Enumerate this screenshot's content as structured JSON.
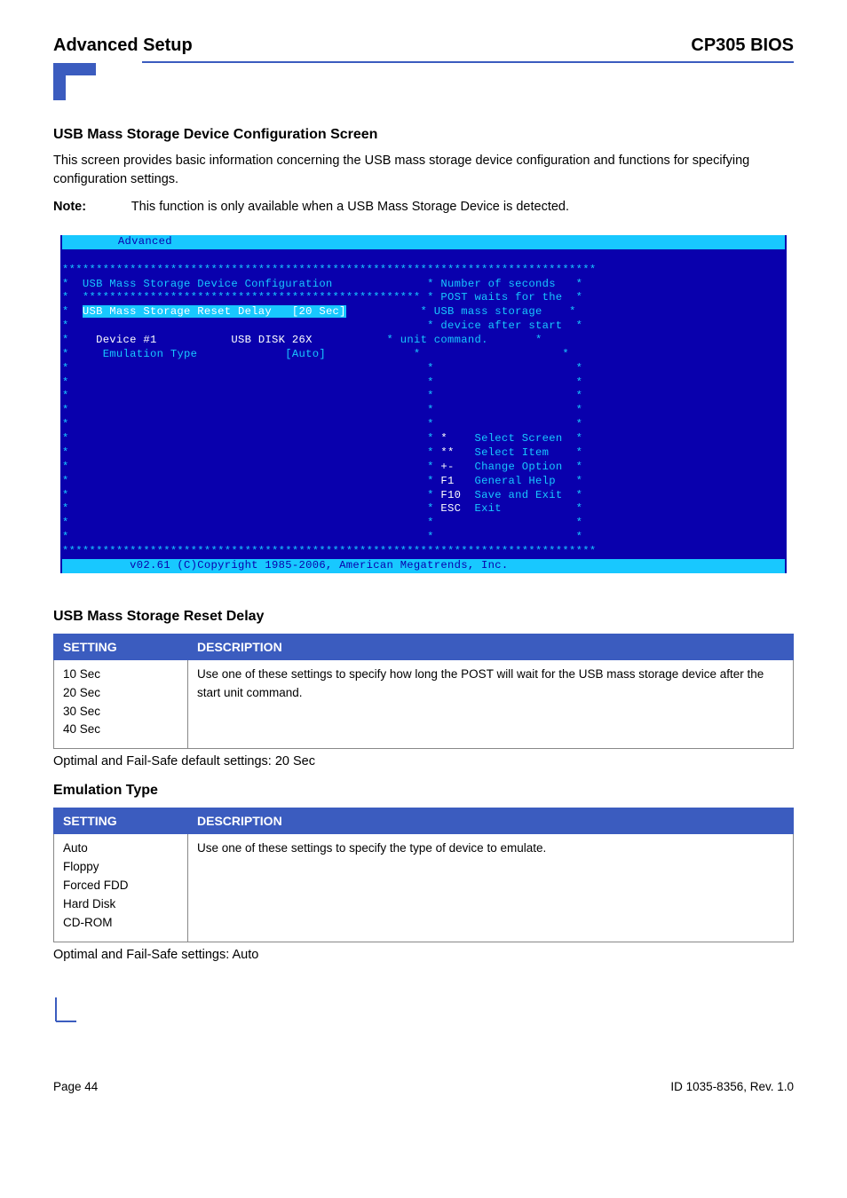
{
  "header": {
    "left": "Advanced Setup",
    "right": "CP305 BIOS"
  },
  "section1": {
    "title": "USB Mass Storage Device Configuration Screen",
    "p1": "This screen provides basic information concerning the USB mass storage device configuration and functions for specifying configuration settings.",
    "note_label": "Note:",
    "note_text": "This function is only available when a USB Mass Storage Device is detected."
  },
  "bios": {
    "tab": "Advanced",
    "title": "USB Mass Storage Device Configuration",
    "reset_delay_label": "USB Mass Storage Reset Delay",
    "reset_delay_value": "[20 Sec]",
    "device_label": "Device #1",
    "device_value": "USB DISK 26X",
    "emu_label": "Emulation Type",
    "emu_value": "[Auto]",
    "help1": "Number of seconds",
    "help2": "POST waits for the",
    "help3": "USB mass storage",
    "help4": "device after start",
    "help5": "unit command.",
    "nav1_key": "*",
    "nav1_txt": "Select Screen",
    "nav2_key": "**",
    "nav2_txt": "Select Item",
    "nav3_key": "+-",
    "nav3_txt": "Change Option",
    "nav4_key": "F1",
    "nav4_txt": "General Help",
    "nav5_key": "F10",
    "nav5_txt": "Save and Exit",
    "nav6_key": "ESC",
    "nav6_txt": "Exit",
    "footer": "v02.61 (C)Copyright 1985-2006, American Megatrends, Inc."
  },
  "table_headers": {
    "setting": "Setting",
    "description": "Description"
  },
  "reset_delay": {
    "title": "USB Mass Storage Reset Delay",
    "settings": [
      "10 Sec",
      "20 Sec",
      "30 Sec",
      "40 Sec"
    ],
    "description": "Use one of these settings to specify how long the POST will wait for the USB mass storage device after the start unit command.",
    "default": "Optimal and Fail-Safe default settings: 20 Sec"
  },
  "emulation": {
    "title": "Emulation Type",
    "settings": [
      "Auto",
      "Floppy",
      "Forced FDD",
      "Hard Disk",
      "CD-ROM"
    ],
    "description": "Use one of these settings to specify the type of device to emulate.",
    "default": "Optimal and Fail-Safe settings: Auto"
  },
  "footer": {
    "left": "Page 44",
    "right": "ID 1035-8356, Rev. 1.0"
  }
}
